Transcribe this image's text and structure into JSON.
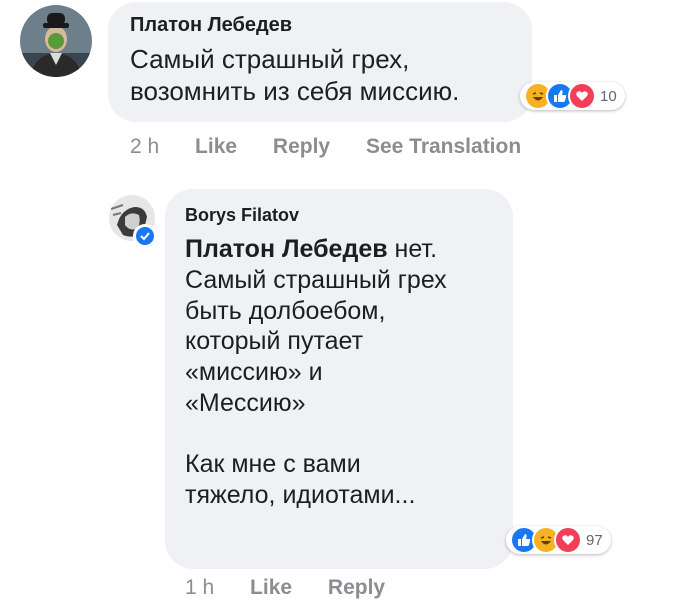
{
  "comment1": {
    "author": "Платон Лебедев",
    "lines": [
      "Самый страшный грех,",
      "возомнить из себя миссию."
    ],
    "reaction_icons": [
      "haha-icon",
      "like-icon",
      "love-icon"
    ],
    "reaction_count": "10",
    "time": "2 h",
    "like_label": "Like",
    "reply_label": "Reply",
    "translate_label": "See Translation"
  },
  "comment2": {
    "author": "Borys Filatov",
    "mention": "Платон Лебедев",
    "first_line_rest": " нет.",
    "lines": [
      "Самый страшный грех",
      "быть долбоебом,",
      "который путает",
      "«миссию» и",
      "«Мессию»",
      "",
      "Как мне с вами",
      "тяжело, идиотами..."
    ],
    "reaction_icons": [
      "like-icon",
      "haha-icon",
      "love-icon"
    ],
    "reaction_count": "97",
    "time": "1 h",
    "like_label": "Like",
    "reply_label": "Reply"
  },
  "colors": {
    "bubble": "#f0f1f4",
    "like": "#1877f2",
    "love": "#f33e58",
    "haha": "#f7b125",
    "meta_text": "#8a8d91"
  }
}
